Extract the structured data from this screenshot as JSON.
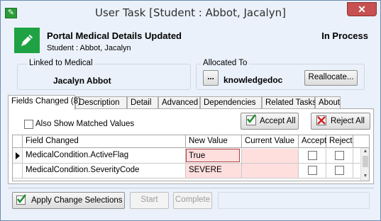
{
  "window": {
    "title": "User Task [Student : Abbot, Jacalyn]",
    "close_glyph": "✕",
    "app_icon_glyph": "✎"
  },
  "header": {
    "title": "Portal Medical Details Updated",
    "subtitle": "Student : Abbot, Jacalyn",
    "status": "In Process",
    "icon": "pencil-icon",
    "icon_color": "#1ea243"
  },
  "linked": {
    "label": "Linked to Medical",
    "name": "Jacalyn Abbot"
  },
  "allocated": {
    "label": "Allocated To",
    "browse_label": "...",
    "user": "knowledgedoc",
    "reallocate_label": "Reallocate..."
  },
  "tabs": [
    {
      "label": "Fields Changed (8)",
      "active": true
    },
    {
      "label": "Description"
    },
    {
      "label": "Detail"
    },
    {
      "label": "Advanced"
    },
    {
      "label": "Dependencies"
    },
    {
      "label": "Related Tasks"
    },
    {
      "label": "About"
    }
  ],
  "fields_tab": {
    "show_matched_label": "Also Show Matched Values",
    "show_matched_checked": false,
    "accept_all_label": "Accept All",
    "reject_all_label": "Reject All",
    "columns": [
      "Field Changed",
      "New Value",
      "Current Value",
      "Accept",
      "Reject"
    ],
    "rows": [
      {
        "field": "MedicalCondition.ActiveFlag",
        "new_value": "True",
        "current_value": "",
        "accept": false,
        "reject": false,
        "current": true
      },
      {
        "field": "MedicalCondition.SeverityCode",
        "new_value": "SEVERE",
        "current_value": "",
        "accept": false,
        "reject": false,
        "current": false
      }
    ]
  },
  "footer": {
    "apply_label": "Apply Change Selections",
    "start_label": "Start",
    "complete_label": "Complete"
  },
  "colors": {
    "accept_green": "#1c8f2c",
    "reject_red": "#d42020",
    "highlight_pink": "#ffdede"
  }
}
